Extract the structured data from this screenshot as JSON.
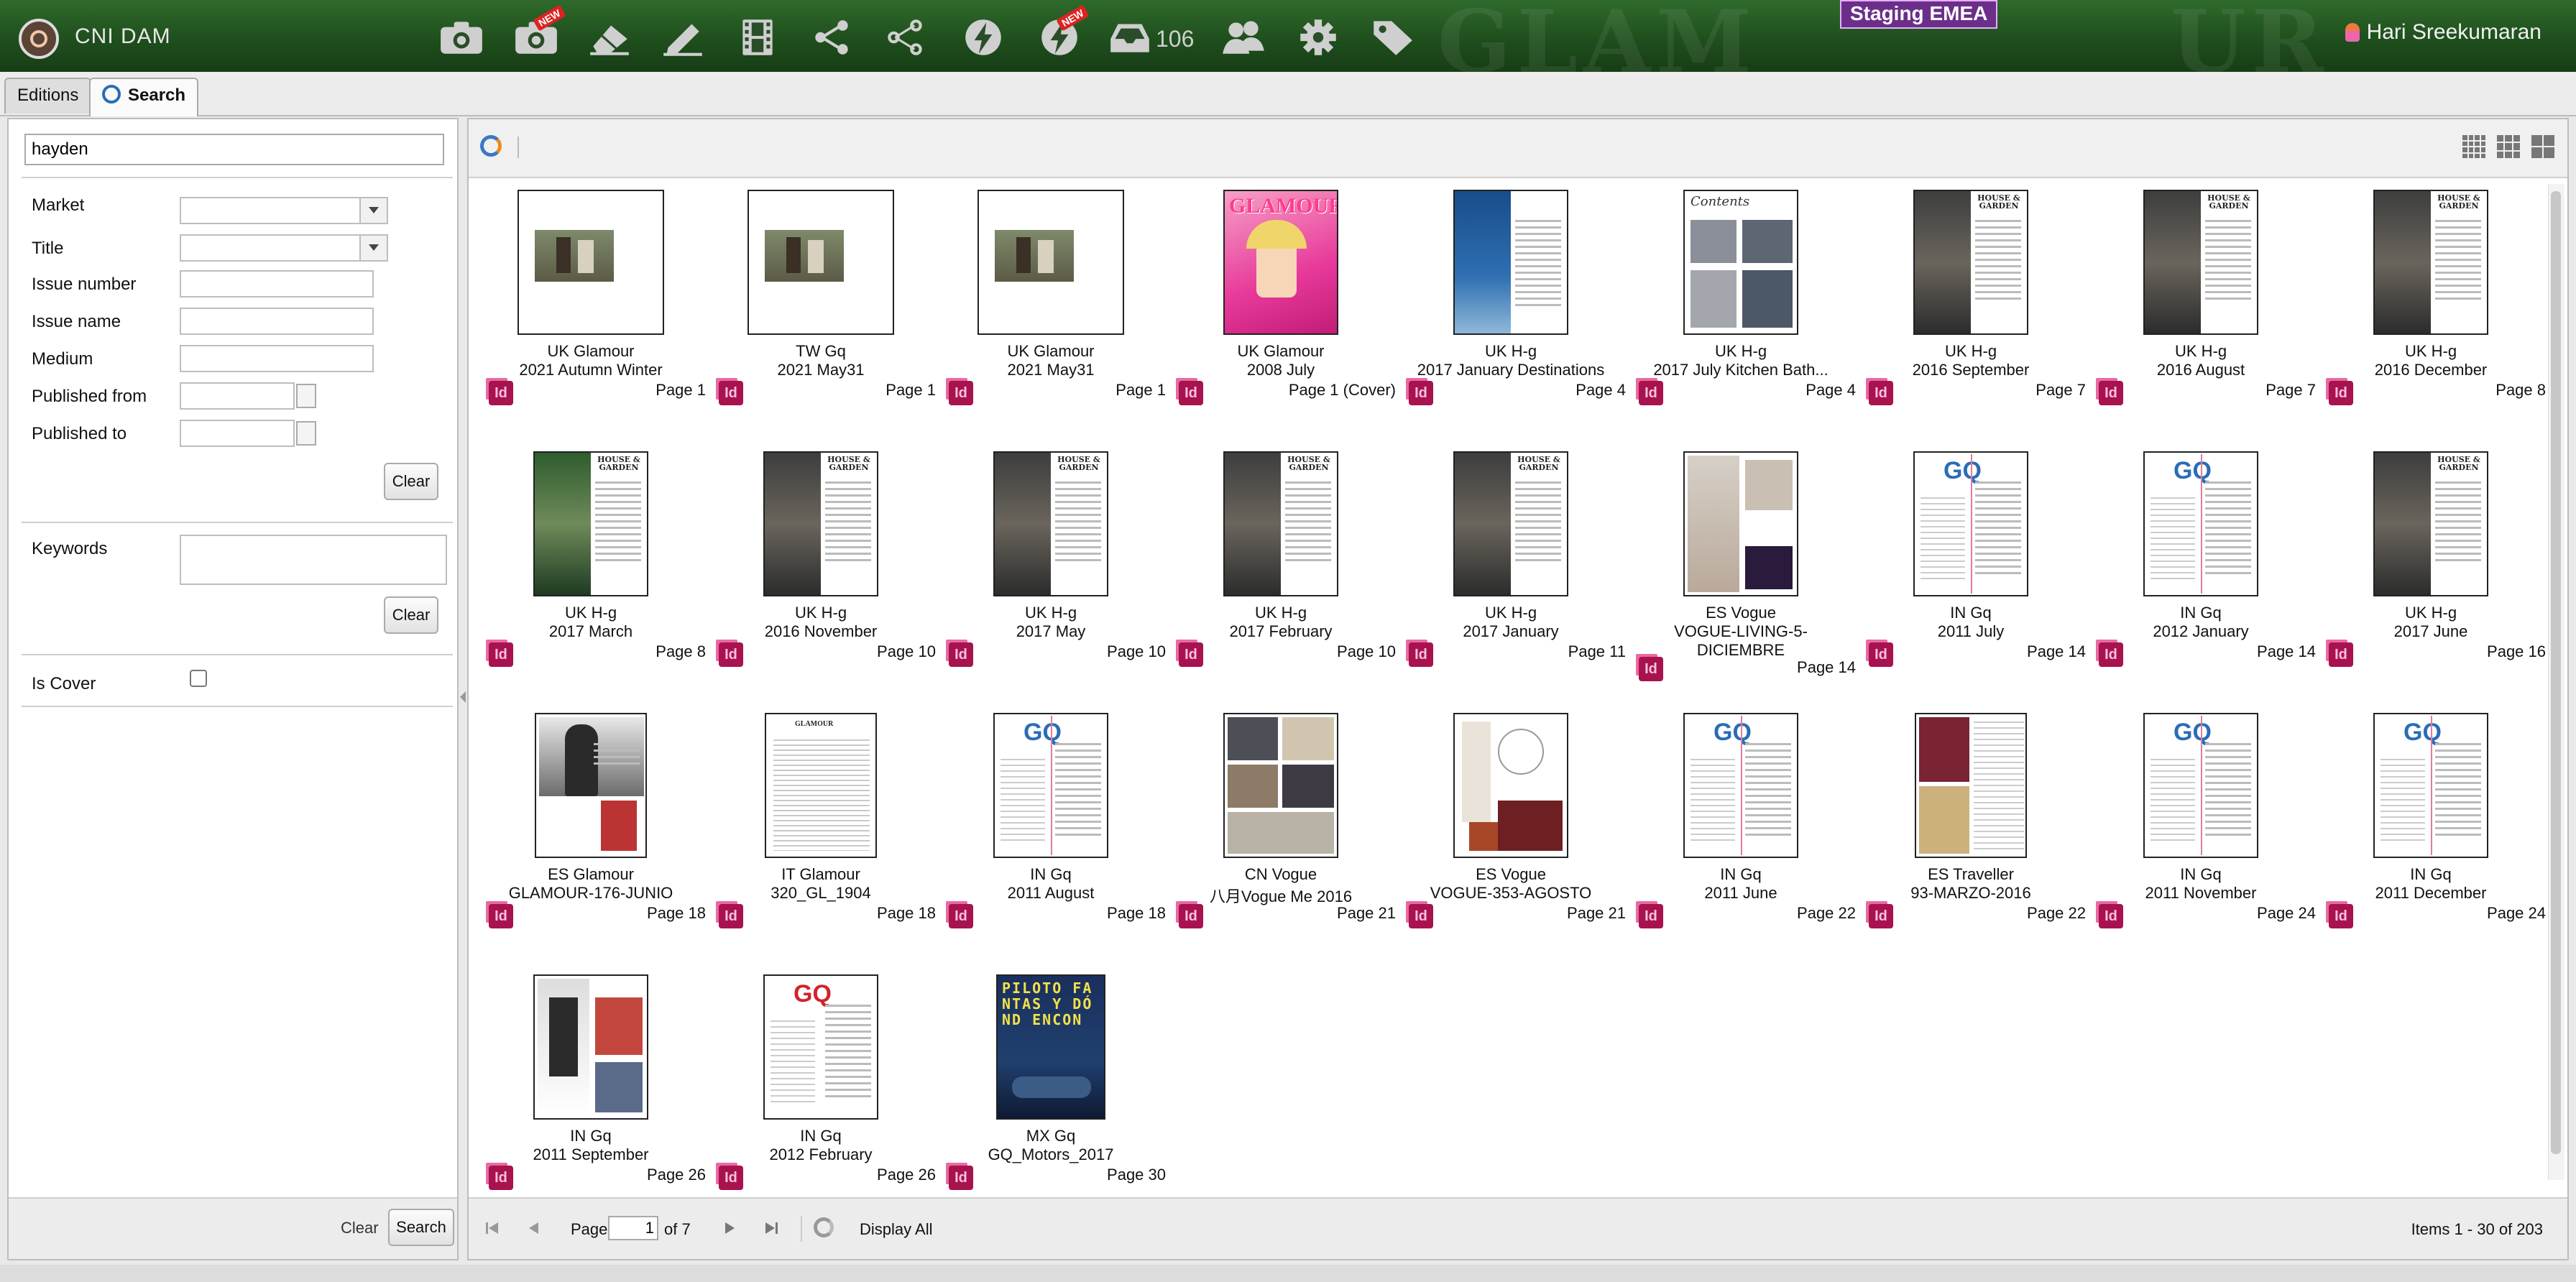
{
  "app": {
    "name": "CNI DAM",
    "environment": "Staging EMEA",
    "user": "Hari Sreekumaran",
    "inbox_count": "106"
  },
  "toolbar": {
    "icons": [
      "camera-icon",
      "camera-new-icon",
      "eraser-icon",
      "pen-icon",
      "film-icon",
      "share-icon",
      "share-alt-icon",
      "lightning-icon",
      "lightning-new-icon",
      "inbox-icon",
      "users-icon",
      "gear-icon",
      "tag-icon"
    ],
    "new_badge": "NEW"
  },
  "tabs": [
    {
      "label": "Editions"
    },
    {
      "label": "Search"
    }
  ],
  "search": {
    "query": "hayden",
    "fields": {
      "market": "Market",
      "title": "Title",
      "issue_number": "Issue number",
      "issue_name": "Issue name",
      "medium": "Medium",
      "published_from": "Published from",
      "published_to": "Published to",
      "keywords": "Keywords",
      "is_cover": "Is Cover"
    },
    "clear_label": "Clear",
    "search_label": "Search"
  },
  "results": {
    "tiles": [
      {
        "line1": "UK Glamour",
        "line2": "2021 Autumn Winter",
        "page": "Page 1",
        "kind": "photo"
      },
      {
        "line1": "TW Gq",
        "line2": "2021 May31",
        "page": "Page 1",
        "kind": "photo"
      },
      {
        "line1": "UK Glamour",
        "line2": "2021 May31",
        "page": "Page 1",
        "kind": "photo"
      },
      {
        "line1": "UK Glamour",
        "line2": "2008 July",
        "page": "Page 1 (Cover)",
        "kind": "cover"
      },
      {
        "line1": "UK H-g",
        "line2": "2017 January Destinations",
        "page": "Page 4",
        "kind": "spread-blue"
      },
      {
        "line1": "UK H-g",
        "line2": "2017 July Kitchen Bath...",
        "page": "Page 4",
        "kind": "contents"
      },
      {
        "line1": "UK H-g",
        "line2": "2016 September",
        "page": "Page 7",
        "kind": "hg"
      },
      {
        "line1": "UK H-g",
        "line2": "2016 August",
        "page": "Page 7",
        "kind": "hg"
      },
      {
        "line1": "UK H-g",
        "line2": "2016 December",
        "page": "Page 8",
        "kind": "hg"
      },
      {
        "line1": "UK H-g",
        "line2": "2017 March",
        "page": "Page 8",
        "kind": "hg-green"
      },
      {
        "line1": "UK H-g",
        "line2": "2016 November",
        "page": "Page 10",
        "kind": "hg"
      },
      {
        "line1": "UK H-g",
        "line2": "2017 May",
        "page": "Page 10",
        "kind": "hg"
      },
      {
        "line1": "UK H-g",
        "line2": "2017 February",
        "page": "Page 10",
        "kind": "hg"
      },
      {
        "line1": "UK H-g",
        "line2": "2017 January",
        "page": "Page 11",
        "kind": "hg"
      },
      {
        "line1": "ES Vogue",
        "line2": "VOGUE-LIVING-5-",
        "line3": "DICIEMBRE",
        "page": "Page 14",
        "kind": "vogue"
      },
      {
        "line1": "IN Gq",
        "line2": "2011 July",
        "page": "Page 14",
        "kind": "gq-blue"
      },
      {
        "line1": "IN Gq",
        "line2": "2012 January",
        "page": "Page 14",
        "kind": "gq-blue"
      },
      {
        "line1": "UK H-g",
        "line2": "2017 June",
        "page": "Page 16",
        "kind": "hg"
      },
      {
        "line1": "ES Glamour",
        "line2": "GLAMOUR-176-JUNIO",
        "page": "Page 18",
        "kind": "bw"
      },
      {
        "line1": "IT Glamour",
        "line2": "320_GL_1904",
        "page": "Page 18",
        "kind": "text"
      },
      {
        "line1": "IN Gq",
        "line2": "2011 August",
        "page": "Page 18",
        "kind": "gq-blue"
      },
      {
        "line1": "CN Vogue",
        "line2": "八月Vogue Me 2016",
        "page": "Page 21",
        "kind": "collage"
      },
      {
        "line1": "ES Vogue",
        "line2": "VOGUE-353-AGOSTO",
        "page": "Page 21",
        "kind": "fashion"
      },
      {
        "line1": "IN Gq",
        "line2": "2011 June",
        "page": "Page 22",
        "kind": "gq-blue"
      },
      {
        "line1": "ES Traveller",
        "line2": "93-MARZO-2016",
        "page": "Page 22",
        "kind": "travel"
      },
      {
        "line1": "IN Gq",
        "line2": "2011 November",
        "page": "Page 24",
        "kind": "gq-blue"
      },
      {
        "line1": "IN Gq",
        "line2": "2011 December",
        "page": "Page 24",
        "kind": "gq-blue"
      },
      {
        "line1": "IN Gq",
        "line2": "2011 September",
        "page": "Page 26",
        "kind": "gq-photo"
      },
      {
        "line1": "IN Gq",
        "line2": "2012 February",
        "page": "Page 26",
        "kind": "gq-red"
      },
      {
        "line1": "MX Gq",
        "line2": "GQ_Motors_2017",
        "page": "Page 30",
        "kind": "motors"
      }
    ],
    "gq_logo": "GQ",
    "glamour_logo": "GLAMOUR",
    "hg_logo": "HOUSE & GARDEN",
    "contents_label": "Contents",
    "motors_text": "PILOTO FANTAS Y DÓND ENCON"
  },
  "pager": {
    "page_label": "Page",
    "current": "1",
    "of_label": "of 7",
    "display_all": "Display All",
    "items_summary": "Items 1 - 30 of 203"
  },
  "colors": {
    "topbar": "#1f4f1d",
    "env_badge": "#6b2f8a",
    "indesign": "#a8124f",
    "gq_blue": "#2a6db5",
    "gq_red": "#d0242b"
  }
}
